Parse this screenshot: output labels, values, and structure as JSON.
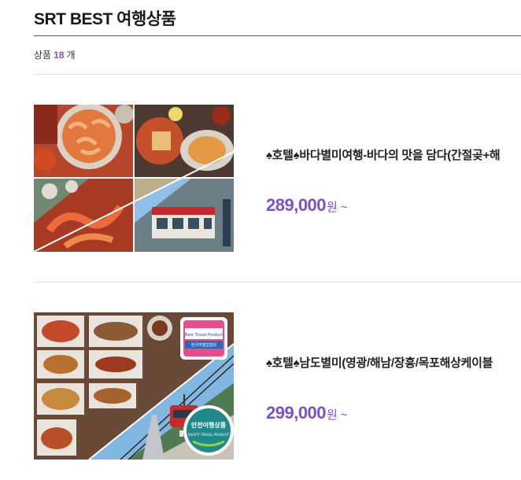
{
  "section": {
    "title": "SRT BEST 여행상품",
    "count_prefix": "상품",
    "count_value": "18",
    "count_suffix": "개"
  },
  "products": [
    {
      "name": "♠호텔♠바다별미여행-바다의 맛을 담다(간절곶+해",
      "price": "289,000",
      "currency": "원",
      "price_suffix": "~"
    },
    {
      "name": "♠호텔♠남도별미(영광/해남/장흥/목포해상케이블",
      "price": "299,000",
      "currency": "원",
      "price_suffix": "~",
      "badge_top": {
        "line1": "Best Travel Product",
        "line2": "한국여행업협회"
      },
      "badge_bottom": {
        "line1": "안전여행상품",
        "line2": "SAFETY TRAVEL PRODUCT"
      }
    }
  ],
  "colors": {
    "accent": "#7a52c7",
    "rule_dark": "#555555",
    "rule_light": "#e2e2e2"
  }
}
